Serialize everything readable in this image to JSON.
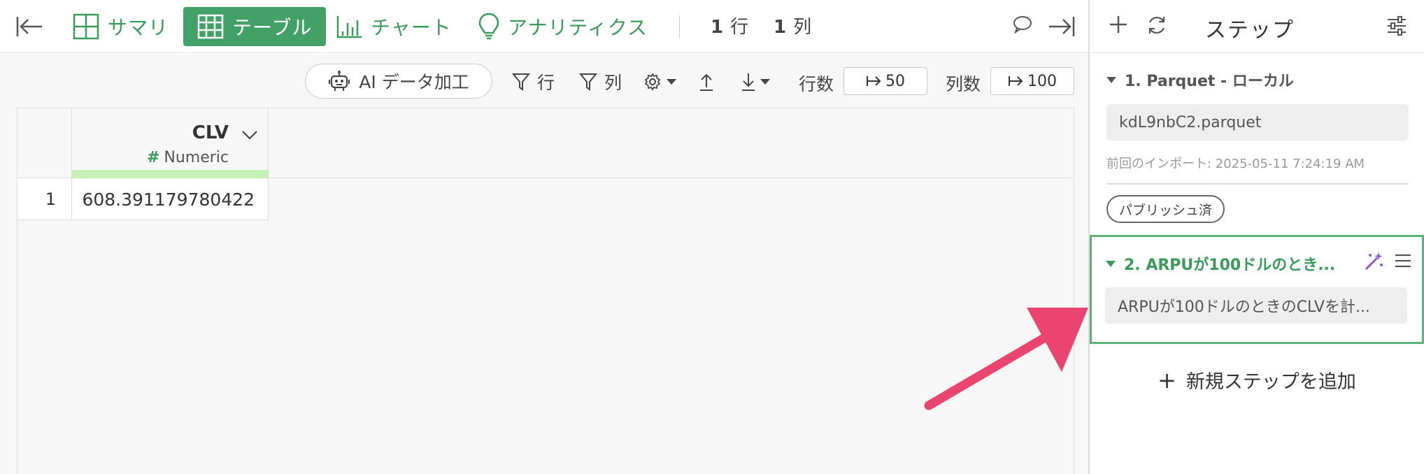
{
  "toolbar": {
    "tabs": [
      {
        "label": "サマリ",
        "icon": "summary-grid-icon"
      },
      {
        "label": "テーブル",
        "icon": "table-icon"
      },
      {
        "label": "チャート",
        "icon": "chart-icon"
      },
      {
        "label": "アナリティクス",
        "icon": "lightbulb-icon"
      }
    ],
    "rows_count": "1",
    "rows_unit": "行",
    "cols_count": "1",
    "cols_unit": "列"
  },
  "subtoolbar": {
    "ai_label": "AI データ加工",
    "filter_rows": "行",
    "filter_cols": "列",
    "row_count_label": "行数",
    "row_count_value": "50",
    "col_count_label": "列数",
    "col_count_value": "100"
  },
  "table": {
    "column": {
      "name": "CLV",
      "type": "Numeric"
    },
    "rows": [
      {
        "index": "1",
        "value": "608.391179780422"
      }
    ]
  },
  "panel": {
    "title": "ステップ",
    "steps": [
      {
        "title": "1. Parquet - ローカル",
        "file": "kdL9nbC2.parquet",
        "import_info": "前回のインポート: 2025-05-11 7:24:19 AM",
        "badge": "パブリッシュ済"
      },
      {
        "title": "2. ARPUが100ドルのとき...",
        "description": "ARPUが100ドルのときのCLVを計..."
      }
    ],
    "add_step": "新規ステップを追加"
  },
  "colors": {
    "accent_green": "#43a067",
    "highlight_border": "#5cb27a",
    "arrow": "#ea4570",
    "wand": "#8a5cc9"
  }
}
